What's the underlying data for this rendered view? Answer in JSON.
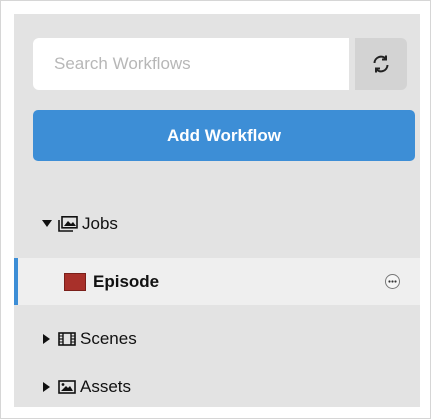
{
  "search": {
    "placeholder": "Search Workflows",
    "value": ""
  },
  "toolbar": {
    "refresh_icon": "refresh-icon"
  },
  "add_workflow": {
    "label": "Add Workflow"
  },
  "tree": {
    "jobs": {
      "label": "Jobs",
      "expanded": true,
      "icon": "image-folder-icon"
    },
    "episode": {
      "label": "Episode",
      "selected": true,
      "swatch_color": "#a8302a",
      "accent_color": "#3d8ed6"
    },
    "scenes": {
      "label": "Scenes",
      "expanded": false,
      "icon": "film-icon"
    },
    "assets": {
      "label": "Assets",
      "expanded": false,
      "icon": "image-icon"
    }
  }
}
